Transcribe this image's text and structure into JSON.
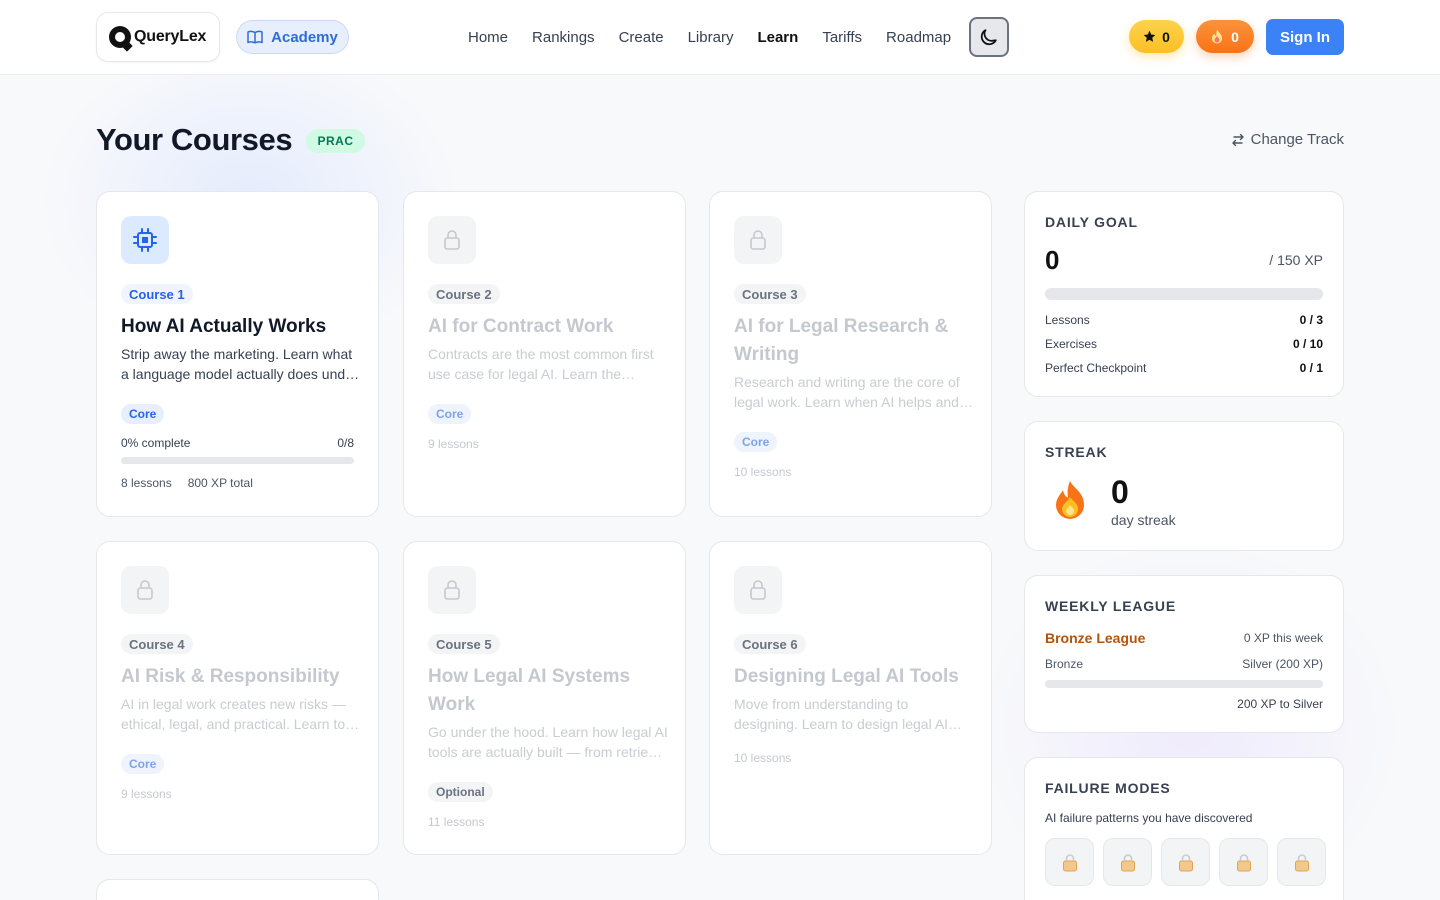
{
  "header": {
    "logo_text": "QueryLex",
    "academy_label": "Academy",
    "nav": [
      {
        "label": "Home",
        "active": false
      },
      {
        "label": "Rankings",
        "active": false
      },
      {
        "label": "Create",
        "active": false
      },
      {
        "label": "Library",
        "active": false
      },
      {
        "label": "Learn",
        "active": true
      },
      {
        "label": "Tariffs",
        "active": false
      },
      {
        "label": "Roadmap",
        "active": false
      }
    ],
    "xp_count": "0",
    "streak_count": "0",
    "signin_label": "Sign In"
  },
  "page": {
    "title": "Your Courses",
    "track_badge": "PRAC",
    "change_track_label": "Change Track"
  },
  "courses": [
    {
      "tag": "Course 1",
      "title": "How AI Actually Works",
      "desc": "Strip away the marketing. Learn what a language model actually does under the hood.",
      "type": "Core",
      "progress_label": "0% complete",
      "progress_count": "0/8",
      "progress": 0,
      "lessons": "8 lessons",
      "xp_total": "800 XP total",
      "locked": false
    },
    {
      "tag": "Course 2",
      "title": "AI for Contract Work",
      "desc": "Contracts are the most common first use case for legal AI. Learn the workflows.",
      "type": "Core",
      "lessons": "9 lessons",
      "locked": true
    },
    {
      "tag": "Course 3",
      "title": "AI for Legal Research & Writing",
      "desc": "Research and writing are the core of legal work. Learn when AI helps and when it hurts.",
      "type": "Core",
      "lessons": "10 lessons",
      "locked": true
    },
    {
      "tag": "Course 4",
      "title": "AI Risk & Responsibility",
      "desc": "AI in legal work creates new risks — ethical, legal, and practical. Learn to manage them.",
      "type": "Core",
      "lessons": "9 lessons",
      "locked": true
    },
    {
      "tag": "Course 5",
      "title": "How Legal AI Systems Work",
      "desc": "Go under the hood. Learn how legal AI tools are actually built — from retrieval to output.",
      "type": "Optional",
      "lessons": "11 lessons",
      "locked": true
    },
    {
      "tag": "Course 6",
      "title": "Designing Legal AI Tools",
      "desc": "Move from understanding to designing. Learn to design legal AI tools that work.",
      "type": "",
      "lessons": "10 lessons",
      "locked": true
    }
  ],
  "daily_goal": {
    "heading": "DAILY GOAL",
    "value": "0",
    "target": "/ 150 XP",
    "progress": 0,
    "rows": [
      {
        "label": "Lessons",
        "value": "0 / 3"
      },
      {
        "label": "Exercises",
        "value": "0 / 10"
      },
      {
        "label": "Perfect Checkpoint",
        "value": "0 / 1"
      }
    ]
  },
  "streak": {
    "heading": "STREAK",
    "value": "0",
    "label": "day streak"
  },
  "league": {
    "heading": "WEEKLY LEAGUE",
    "name": "Bronze League",
    "xp_week": "0 XP this week",
    "from": "Bronze",
    "to": "Silver (200 XP)",
    "progress": 0,
    "remaining": "200 XP to Silver"
  },
  "failure_modes": {
    "heading": "FAILURE MODES",
    "subtitle": "AI failure patterns you have discovered",
    "slots": 5
  },
  "colors": {
    "accent": "#3b82f6",
    "prac_badge_bg": "#d1fae5",
    "bronze": "#b45309",
    "xp_pill": "#fbbf24",
    "fire_pill": "#f97316"
  }
}
